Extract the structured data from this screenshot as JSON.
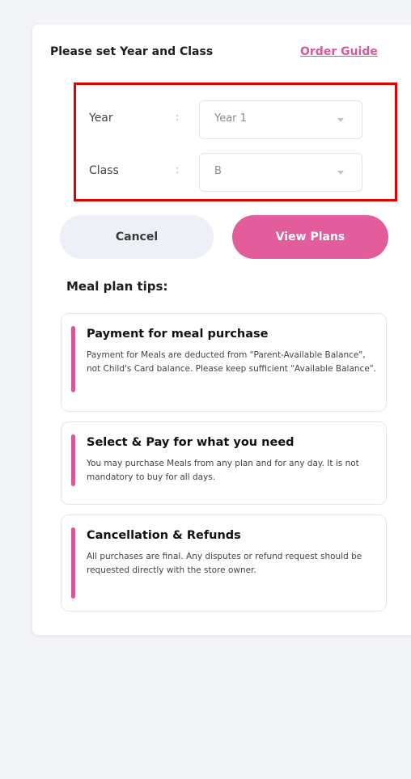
{
  "header": {
    "title": "Please set Year and Class",
    "guide_link": "Order Guide"
  },
  "form": {
    "year": {
      "label": "Year",
      "separator": ":",
      "value": "Year 1"
    },
    "class": {
      "label": "Class",
      "separator": ":",
      "value": "B"
    }
  },
  "actions": {
    "cancel": "Cancel",
    "view_plans": "View Plans"
  },
  "tips": {
    "title": "Meal plan tips:",
    "items": [
      {
        "heading": "Payment for meal purchase",
        "body": "Payment for Meals are deducted from \"Parent-Available Balance\", not Child's Card balance. Please keep sufficient \"Available Balance\"."
      },
      {
        "heading": "Select & Pay for what you need",
        "body": "You may purchase Meals from any plan and for any day. It is not mandatory to buy for all days."
      },
      {
        "heading": "Cancellation & Refunds",
        "body": "All purchases are final. Any disputes or refund request should be requested directly with the store owner."
      }
    ]
  },
  "colors": {
    "accent": "#e35d9d",
    "highlight_border": "#e00000",
    "background": "#f3f4f8"
  }
}
